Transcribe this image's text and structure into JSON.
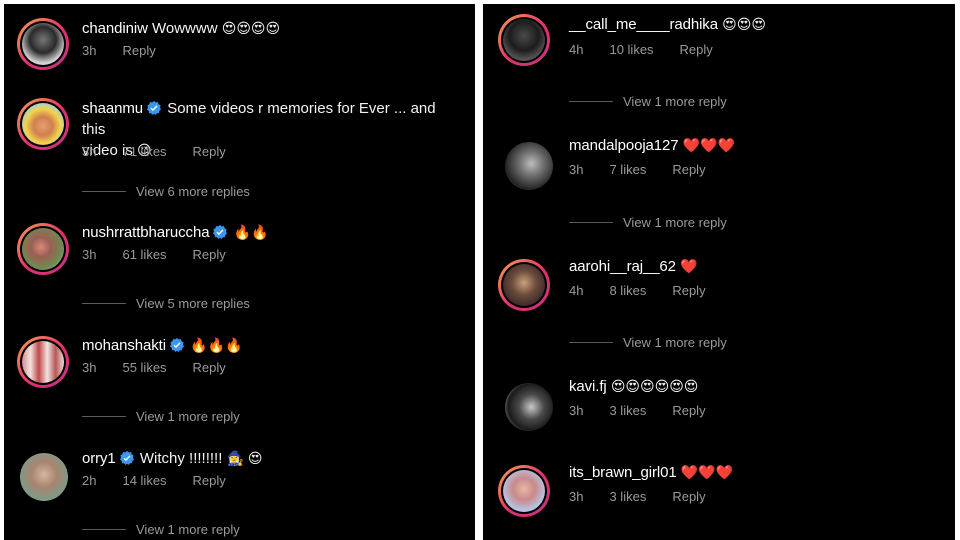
{
  "left": {
    "comments": [
      {
        "username": "chandiniw",
        "verified": false,
        "text": "Wowwww",
        "emoji": "😍😍😍😍",
        "time": "3h",
        "likes": "",
        "reply": "Reply"
      },
      {
        "username": "shaanmu",
        "verified": true,
        "text": "Some videos r memories for Ever ... and this",
        "text2": "video is",
        "emoji": "😉",
        "time": "3h",
        "likes": "71 likes",
        "reply": "Reply",
        "more": "View 6 more replies"
      },
      {
        "username": "nushrrattbharuccha",
        "verified": true,
        "text": "",
        "emoji": "🔥🔥",
        "time": "3h",
        "likes": "61 likes",
        "reply": "Reply",
        "more": "View 5 more replies"
      },
      {
        "username": "mohanshakti",
        "verified": true,
        "text": "",
        "emoji": "🔥🔥🔥",
        "time": "3h",
        "likes": "55 likes",
        "reply": "Reply",
        "more": "View 1 more reply"
      },
      {
        "username": "orry1",
        "verified": true,
        "text": "Witchy !!!!!!!!",
        "emoji": "🧙‍♀️ 😍",
        "time": "2h",
        "likes": "14 likes",
        "reply": "Reply",
        "more": "View 1 more reply"
      }
    ]
  },
  "right": {
    "comments": [
      {
        "username": "__call_me____radhika",
        "text": "",
        "emoji": "😍😍😍",
        "time": "4h",
        "likes": "10 likes",
        "reply": "Reply",
        "more": "View 1 more reply"
      },
      {
        "username": "mandalpooja127",
        "text": "",
        "emoji": "❤️❤️❤️",
        "time": "3h",
        "likes": "7 likes",
        "reply": "Reply",
        "more": "View 1 more reply"
      },
      {
        "username": "aarohi__raj__62",
        "text": "",
        "emoji": "❤️",
        "time": "4h",
        "likes": "8 likes",
        "reply": "Reply",
        "more": "View 1 more reply"
      },
      {
        "username": "kavi.fj",
        "text": "",
        "emoji": "😍😍😍😍😍😍",
        "time": "3h",
        "likes": "3 likes",
        "reply": "Reply"
      },
      {
        "username": "its_brawn_girl01",
        "text": "",
        "emoji": "❤️❤️❤️",
        "time": "3h",
        "likes": "3 likes",
        "reply": "Reply"
      }
    ]
  },
  "colors": {
    "background": "#000000",
    "text": "#f5f5f5",
    "meta": "#9a9a9a",
    "verified": "#3897f0",
    "ring_start": "#f9a24e",
    "ring_end": "#c13584"
  },
  "icons": {
    "verified": "verified-badge-icon"
  }
}
